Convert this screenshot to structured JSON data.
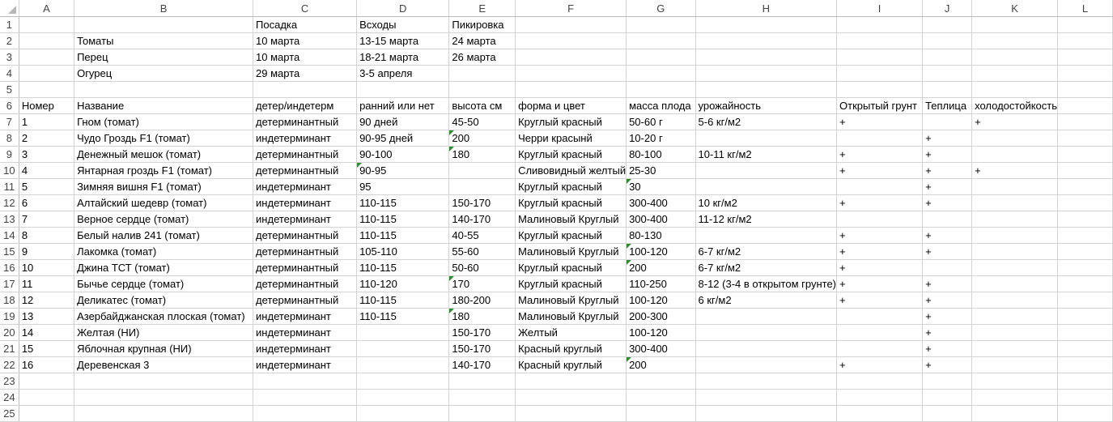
{
  "columns": [
    "A",
    "B",
    "C",
    "D",
    "E",
    "F",
    "G",
    "H",
    "I",
    "J",
    "K",
    "L"
  ],
  "row_numbers": [
    "1",
    "2",
    "3",
    "4",
    "5",
    "6",
    "7",
    "8",
    "9",
    "10",
    "11",
    "12",
    "13",
    "14",
    "15",
    "16",
    "17",
    "18",
    "19",
    "20",
    "21",
    "22",
    "23",
    "24",
    "25"
  ],
  "rows": [
    [
      "",
      "",
      "Посадка",
      "Всходы",
      "Пикировка",
      "",
      "",
      "",
      "",
      "",
      "",
      ""
    ],
    [
      "",
      "Томаты",
      "10 марта",
      "13-15 марта",
      "24 марта",
      "",
      "",
      "",
      "",
      "",
      "",
      ""
    ],
    [
      "",
      "Перец",
      "10 марта",
      "18-21 марта",
      "26 марта",
      "",
      "",
      "",
      "",
      "",
      "",
      ""
    ],
    [
      "",
      "Огурец",
      "29 марта",
      "3-5 апреля",
      "",
      "",
      "",
      "",
      "",
      "",
      "",
      ""
    ],
    [
      "",
      "",
      "",
      "",
      "",
      "",
      "",
      "",
      "",
      "",
      "",
      ""
    ],
    [
      "Номер",
      "Название",
      "детер/индетерм",
      "ранний или нет",
      "высота см",
      "форма и цвет",
      "масса плода",
      "урожайность",
      "Открытый грунт",
      "Теплица",
      "холодостойкость",
      ""
    ],
    [
      "1",
      "Гном (томат)",
      "детерминантный",
      "90 дней",
      "45-50",
      "Круглый красный",
      "50-60 г",
      "5-6 кг/м2",
      "+",
      "",
      "+",
      ""
    ],
    [
      "2",
      "Чудо Гроздь F1 (томат)",
      "индетерминант",
      "90-95 дней",
      "200",
      "Черри красынй",
      "10-20 г",
      "",
      "",
      "+",
      "",
      ""
    ],
    [
      "3",
      "Денежный мешок (томат)",
      "детерминантный",
      "90-100",
      "180",
      "Круглый красный",
      "80-100",
      "10-11 кг/м2",
      "+",
      "+",
      "",
      ""
    ],
    [
      "4",
      "Янтарная гроздь F1 (томат)",
      "детерминантный",
      "90-95",
      "",
      "Сливовидный желтый",
      "25-30",
      "",
      "+",
      "+",
      "+",
      ""
    ],
    [
      "5",
      "Зимняя вишня F1 (томат)",
      "индетерминант",
      "95",
      "",
      "Круглый красный",
      "30",
      "",
      "",
      "+",
      "",
      ""
    ],
    [
      "6",
      "Алтайский шедевр (томат)",
      "индетерминант",
      "110-115",
      "150-170",
      "Круглый красный",
      "300-400",
      "10 кг/м2",
      "+",
      "+",
      "",
      ""
    ],
    [
      "7",
      "Верное сердце (томат)",
      "индетерминант",
      "110-115",
      "140-170",
      "Малиновый Круглый",
      "300-400",
      "11-12 кг/м2",
      "",
      "",
      "",
      ""
    ],
    [
      "8",
      "Белый налив 241 (томат)",
      "детерминантный",
      "110-115",
      "40-55",
      "Круглый красный",
      "80-130",
      "",
      "+",
      "+",
      "",
      ""
    ],
    [
      "9",
      "Лакомка (томат)",
      "детерминантный",
      "105-110",
      "55-60",
      "Малиновый Круглый",
      "100-120",
      "6-7 кг/м2",
      "+",
      "+",
      "",
      ""
    ],
    [
      "10",
      "Джина ТСТ (томат)",
      "детерминантный",
      "110-115",
      "50-60",
      "Круглый красный",
      "200",
      "6-7 кг/м2",
      "+",
      "",
      "",
      ""
    ],
    [
      "11",
      "Бычье сердце (томат)",
      "детерминантный",
      "110-120",
      "170",
      "Круглый красный",
      "110-250",
      "8-12 (3-4 в открытом грунте)",
      "+",
      "+",
      "",
      ""
    ],
    [
      "12",
      "Деликатес (томат)",
      "детерминантный",
      "110-115",
      "180-200",
      "Малиновый Круглый",
      "100-120",
      "6 кг/м2",
      "+",
      "+",
      "",
      ""
    ],
    [
      "13",
      "Азербайджанская плоская (томат)",
      "индетерминант",
      "110-115",
      "180",
      "Малиновый Круглый",
      "200-300",
      "",
      "",
      "+",
      "",
      ""
    ],
    [
      "14",
      "Желтая (НИ)",
      "индетерминант",
      "",
      "150-170",
      "Желтый",
      "100-120",
      "",
      "",
      "+",
      "",
      ""
    ],
    [
      "15",
      "Яблочная крупная (НИ)",
      "индетерминант",
      "",
      "150-170",
      "Красный круглый",
      "300-400",
      "",
      "",
      "+",
      "",
      ""
    ],
    [
      "16",
      "Деревенская 3",
      "индетерминант",
      "",
      "140-170",
      "Красный круглый",
      "200",
      "",
      "+",
      "+",
      "",
      ""
    ],
    [
      "",
      "",
      "",
      "",
      "",
      "",
      "",
      "",
      "",
      "",
      "",
      ""
    ],
    [
      "",
      "",
      "",
      "",
      "",
      "",
      "",
      "",
      "",
      "",
      "",
      ""
    ],
    [
      "",
      "",
      "",
      "",
      "",
      "",
      "",
      "",
      "",
      "",
      "",
      ""
    ]
  ],
  "colors": {
    "grid_line": "#d4d4d4",
    "header_text": "#444444",
    "error_flag": "#2e8b2e"
  }
}
